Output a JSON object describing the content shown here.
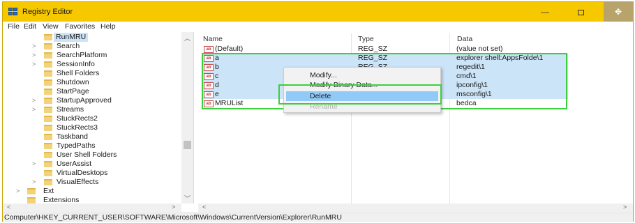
{
  "window": {
    "title": "Registry Editor",
    "min_glyph": "—",
    "close_glyph": "✥"
  },
  "menu": [
    "File",
    "Edit",
    "View",
    "Favorites",
    "Help"
  ],
  "tree": {
    "items": [
      {
        "label": "RunMRU",
        "expander": "",
        "selected": true
      },
      {
        "label": "Search",
        "expander": ">"
      },
      {
        "label": "SearchPlatform",
        "expander": ">"
      },
      {
        "label": "SessionInfo",
        "expander": ">"
      },
      {
        "label": "Shell Folders",
        "expander": ""
      },
      {
        "label": "Shutdown",
        "expander": ""
      },
      {
        "label": "StartPage",
        "expander": ""
      },
      {
        "label": "StartupApproved",
        "expander": ">"
      },
      {
        "label": "Streams",
        "expander": ">"
      },
      {
        "label": "StuckRects2",
        "expander": ""
      },
      {
        "label": "StuckRects3",
        "expander": ""
      },
      {
        "label": "Taskband",
        "expander": ""
      },
      {
        "label": "TypedPaths",
        "expander": ""
      },
      {
        "label": "User Shell Folders",
        "expander": ""
      },
      {
        "label": "UserAssist",
        "expander": ">"
      },
      {
        "label": "VirtualDesktops",
        "expander": ""
      },
      {
        "label": "VisualEffects",
        "expander": ">"
      },
      {
        "label": "Ext",
        "expander": ">"
      },
      {
        "label": "Extensions",
        "expander": ""
      }
    ]
  },
  "list": {
    "columns": {
      "name": "Name",
      "type": "Type",
      "data": "Data"
    },
    "rows": [
      {
        "name": "(Default)",
        "type": "REG_SZ",
        "data": "(value not set)",
        "highlight": false
      },
      {
        "name": "a",
        "type": "REG_SZ",
        "data": "explorer shell:AppsFolde\\1",
        "highlight": true
      },
      {
        "name": "b",
        "type": "REG_SZ",
        "data": "regedit\\1",
        "highlight": true
      },
      {
        "name": "c",
        "type": "",
        "data": "cmd\\1",
        "highlight": true
      },
      {
        "name": "d",
        "type": "",
        "data": "ipconfig\\1",
        "highlight": true
      },
      {
        "name": "e",
        "type": "",
        "data": "msconfig\\1",
        "highlight": true
      },
      {
        "name": "MRUList",
        "type": "REG_SZ",
        "data": "bedca",
        "highlight": false
      }
    ]
  },
  "context_menu": {
    "items": [
      {
        "label": "Modify...",
        "state": "normal"
      },
      {
        "label": "Modify Binary Data...",
        "state": "normal"
      },
      {
        "label": "Delete",
        "state": "selected"
      },
      {
        "label": "Rename",
        "state": "disabled"
      }
    ]
  },
  "status": {
    "path": "Computer\\HKEY_CURRENT_USER\\SOFTWARE\\Microsoft\\Windows\\CurrentVersion\\Explorer\\RunMRU"
  },
  "colors": {
    "title_bar": "#f6c800",
    "selection": "#cce4f7",
    "annotation": "#3ccf3c"
  }
}
